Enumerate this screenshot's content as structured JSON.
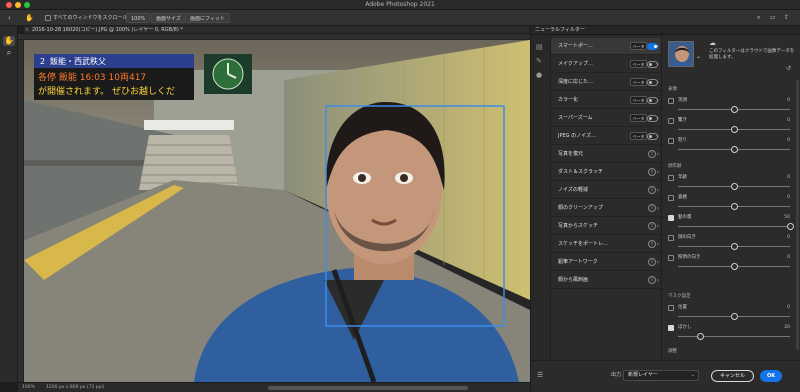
{
  "window": {
    "title": "Adobe Photoshop 2021"
  },
  "options_bar": {
    "scroll_all_label": "すべてのウィンドウをスクロール",
    "zoom_value": "100%",
    "fit_screen_label": "画面サイズ",
    "fill_screen_label": "画面にフィット"
  },
  "document": {
    "tab_title": "2016-10-28 16020(コピー).JPG @ 100% (レイヤー 0, RGB/8) *",
    "status_zoom": "100%",
    "status_size": "1200 px x 800 px (72 ppi)"
  },
  "photo": {
    "sign_line1": "各停 飯能 16:03 10両417",
    "sign_line2": "が開催されます。 ぜひお越しくだ",
    "station_text": "飯能・西武秩父",
    "station_num": "2"
  },
  "panel": {
    "tab_title": "ニューラルフィルター",
    "filters": [
      {
        "label": "スマートポー…",
        "badge": "ベータ",
        "control": "toggle-on"
      },
      {
        "label": "メイクアップ…",
        "badge": "ベータ",
        "control": "toggle-off"
      },
      {
        "label": "深度に応じた…",
        "badge": "ベータ",
        "control": "toggle-off"
      },
      {
        "label": "カラー化",
        "badge": "ベータ",
        "control": "toggle-off"
      },
      {
        "label": "スーパーズーム",
        "badge": "ベータ",
        "control": "toggle-off"
      },
      {
        "label": "JPEG のノイズ…",
        "badge": "ベータ",
        "control": "toggle-off"
      },
      {
        "label": "写真を復元",
        "badge": "",
        "control": "info"
      },
      {
        "label": "ダスト＆スクラッチ",
        "badge": "",
        "control": "info"
      },
      {
        "label": "ノイズの軽減",
        "badge": "",
        "control": "info"
      },
      {
        "label": "顔のクリーンアップ",
        "badge": "",
        "control": "info"
      },
      {
        "label": "写真からスケッチ",
        "badge": "",
        "control": "info"
      },
      {
        "label": "スケッチをポートレ…",
        "badge": "",
        "control": "info"
      },
      {
        "label": "鉛筆アートワーク",
        "badge": "",
        "control": "info"
      },
      {
        "label": "顔から風刺画",
        "badge": "",
        "control": "info"
      }
    ],
    "description": "このフィルターはクラウドで画像データを処理します。",
    "sections": {
      "expression": "表情",
      "facial_age": "顔年齢",
      "mask": "マスク設定",
      "adjust": "調整"
    },
    "sliders": [
      {
        "label": "笑顔",
        "value": "0",
        "checked": false,
        "level": 0.5
      },
      {
        "label": "驚き",
        "value": "0",
        "checked": false,
        "level": 0.5
      },
      {
        "label": "怒り",
        "value": "0",
        "checked": false,
        "level": 0.5
      },
      {
        "label": "年齢",
        "value": "0",
        "checked": false,
        "level": 0.5
      },
      {
        "label": "喜嬉",
        "value": "0",
        "checked": false,
        "level": 0.5
      },
      {
        "label": "髪の量",
        "value": "50",
        "checked": true,
        "level": 1.0
      },
      {
        "label": "顔の向き",
        "value": "0",
        "checked": false,
        "level": 0.5
      },
      {
        "label": "照明の向き",
        "value": "0",
        "checked": false,
        "level": 0.5
      },
      {
        "label": "位置",
        "value": "0",
        "checked": false,
        "level": 0.5
      },
      {
        "label": "ぼかし",
        "value": "20",
        "checked": true,
        "level": 0.2
      }
    ],
    "output_label": "出力",
    "output_value": "新規レイヤー",
    "cancel_label": "キャンセル",
    "ok_label": "OK"
  },
  "colors": {
    "accent": "#1473e6",
    "panel_bg": "#2b2b2b",
    "app_bg": "#1e1e1e"
  }
}
